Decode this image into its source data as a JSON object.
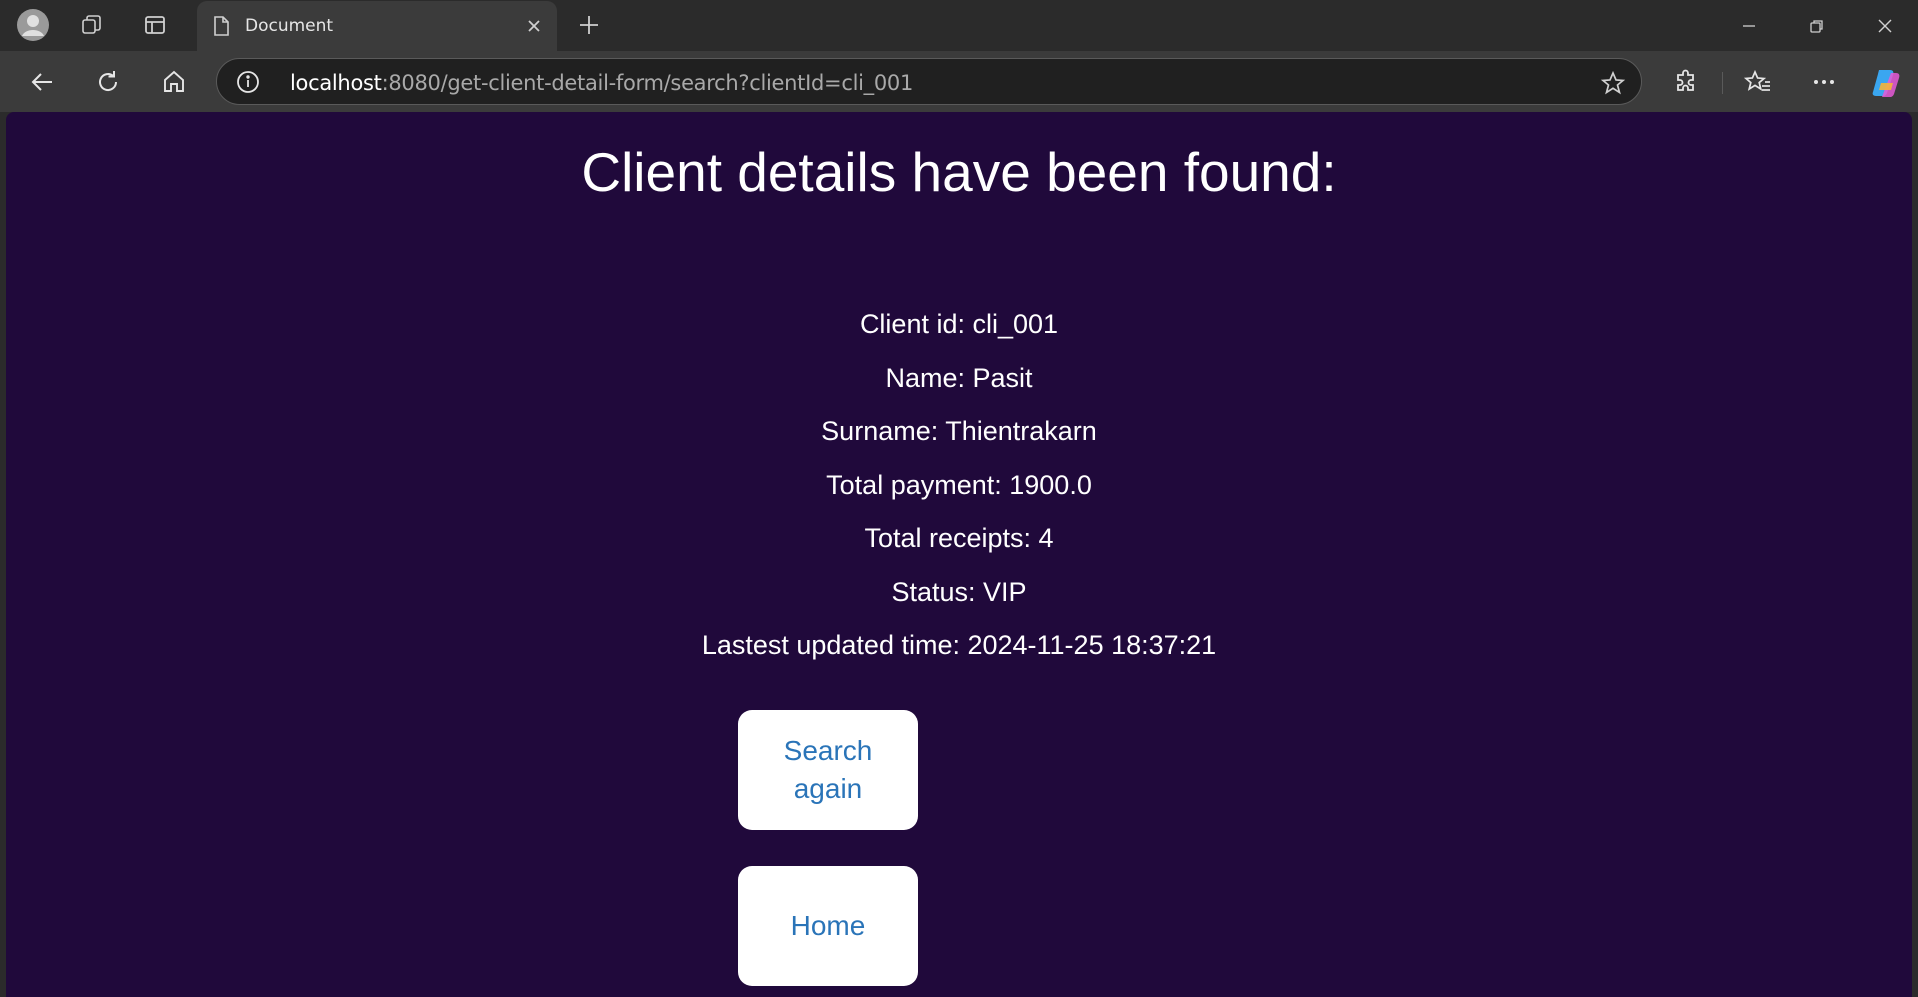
{
  "browser": {
    "tab": {
      "title": "Document"
    },
    "url": {
      "host": "localhost",
      "rest": ":8080/get-client-detail-form/search?clientId=cli_001"
    },
    "icons": {
      "profile": "profile-icon",
      "workspaces": "workspaces-icon",
      "tab_actions": "tab-actions-icon",
      "new_tab": "plus-icon",
      "back": "back-arrow-icon",
      "refresh": "refresh-icon",
      "home": "home-icon",
      "site_info": "info-icon",
      "favorite": "star-icon",
      "extensions": "puzzle-icon",
      "favorites": "favorites-icon",
      "more": "more-icon",
      "copilot": "copilot-icon"
    }
  },
  "page": {
    "title": "Client details have been found:",
    "details": [
      "Client id: cli_001",
      "Name: Pasit",
      "Surname: Thientrakarn",
      "Total payment: 1900.0",
      "Total receipts: 4",
      "Status: VIP",
      "Lastest updated time: 2024-11-25 18:37:21"
    ],
    "buttons": {
      "search_again": "Search again",
      "home": "Home"
    }
  },
  "colors": {
    "page_background": "#20093b",
    "button_text": "#2a74b8",
    "browser_chrome": "#3b3b3b"
  }
}
